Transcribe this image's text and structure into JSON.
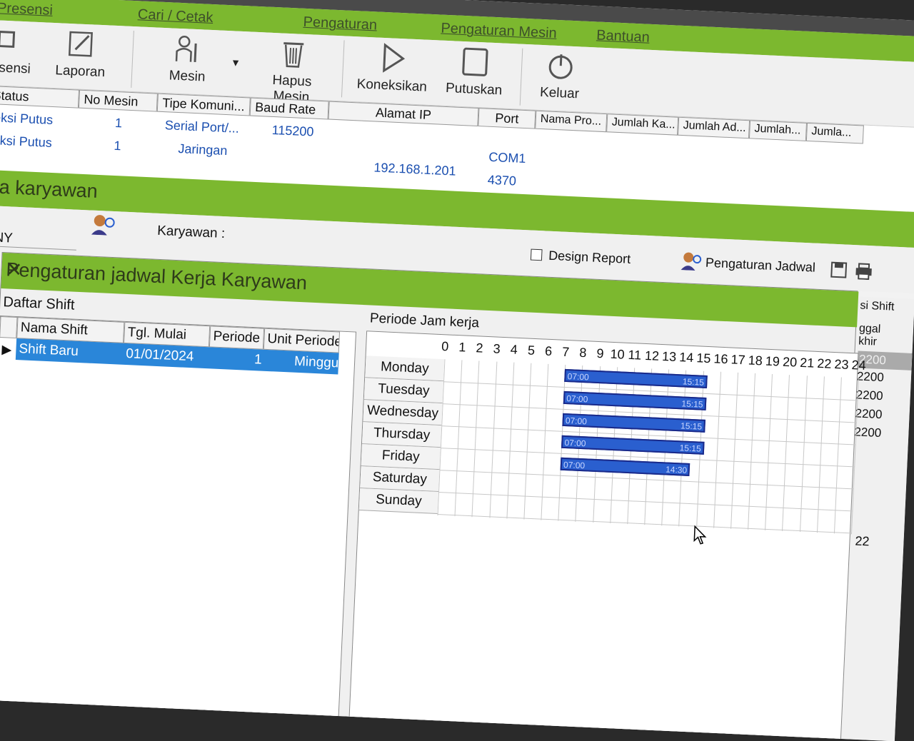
{
  "app": {
    "tab_presensi": "Presensi"
  },
  "menu": {
    "items": [
      "Cari / Cetak",
      "Pengaturan",
      "Pengaturan Mesin",
      "Bantuan"
    ]
  },
  "ribbon": {
    "presensi": "esensi",
    "laporan": "Laporan",
    "mesin": "Mesin",
    "hapus_mesin": "Hapus Mesin",
    "koneksikan": "Koneksikan",
    "putuskan": "Putuskan",
    "keluar": "Keluar"
  },
  "machine_grid": {
    "headers": [
      "Status",
      "No Mesin",
      "Tipe Komuni...",
      "Baud Rate",
      "Alamat IP",
      "Port",
      "Nama Pro...",
      "Jumlah Ka...",
      "Jumlah Ad...",
      "Jumlah...",
      "Jumla..."
    ],
    "rows": [
      {
        "status": "neksi Putus",
        "no_mesin": "1",
        "tipe": "Serial Port/...",
        "baud": "115200",
        "ip": "",
        "port": "COM1"
      },
      {
        "status": "neksi Putus",
        "no_mesin": "1",
        "tipe": "Jaringan",
        "baud": "",
        "ip": "192.168.1.201",
        "port": "4370"
      }
    ]
  },
  "section": {
    "title": "erja karyawan"
  },
  "filter": {
    "label_colon": ":",
    "company": "PANY",
    "karyawan_label": "Karyawan :",
    "design_report": "Design Report",
    "pengaturan_jadwal": "Pengaturan Jadwal"
  },
  "side": {
    "shift_label": "si Shift",
    "tgl_label1": "ggal",
    "tgl_label2": "khir",
    "values": [
      "2200",
      "2200",
      "2200",
      "2200",
      "2200"
    ],
    "bottom": "22"
  },
  "dialog": {
    "title": "Pengaturan jadwal Kerja Karyawan",
    "daftar_shift": "Daftar Shift",
    "periode_jam": "Periode Jam kerja",
    "shift_headers": [
      "Nama Shift",
      "Tgl. Mulai",
      "Periode",
      "Unit Periode"
    ],
    "shift_row": {
      "nama": "Shift Baru",
      "tgl": "01/01/2024",
      "periode": "1",
      "unit": "Minggu"
    },
    "hours": [
      "0",
      "1",
      "2",
      "3",
      "4",
      "5",
      "6",
      "7",
      "8",
      "9",
      "10",
      "11",
      "12",
      "13",
      "14",
      "15",
      "16",
      "17",
      "18",
      "19",
      "20",
      "21",
      "22",
      "23",
      "24"
    ],
    "days": [
      "Monday",
      "Tuesday",
      "Wednesday",
      "Thursday",
      "Friday",
      "Saturday",
      "Sunday"
    ],
    "schedule": [
      {
        "day": "Monday",
        "start": 7.0,
        "end": 15.25,
        "start_label": "07:00",
        "end_label": "15:15"
      },
      {
        "day": "Tuesday",
        "start": 7.0,
        "end": 15.25,
        "start_label": "07:00",
        "end_label": "15:15"
      },
      {
        "day": "Wednesday",
        "start": 7.0,
        "end": 15.25,
        "start_label": "07:00",
        "end_label": "15:15"
      },
      {
        "day": "Thursday",
        "start": 7.0,
        "end": 15.25,
        "start_label": "07:00",
        "end_label": "15:15"
      },
      {
        "day": "Friday",
        "start": 7.0,
        "end": 14.5,
        "start_label": "07:00",
        "end_label": "14:30"
      }
    ]
  },
  "colors": {
    "green": "#7cb82f",
    "selection": "#2a86d9",
    "bar": "#2a5fcf"
  }
}
